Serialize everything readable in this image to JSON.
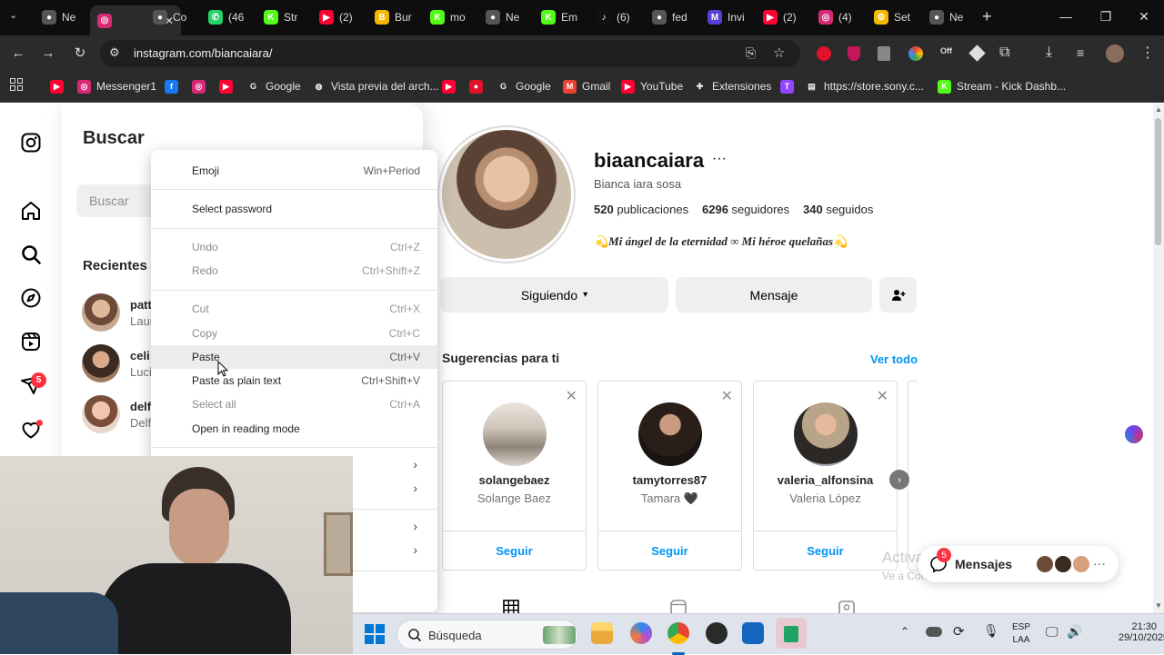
{
  "browser": {
    "tabs": [
      {
        "label": "Ne",
        "icon": "chrome-icon",
        "color": "#555555"
      },
      {
        "label": "",
        "icon": "instagram-icon",
        "color": "#d62976",
        "active": true
      },
      {
        "label": "Co",
        "icon": "chrome-icon",
        "color": "#555555"
      },
      {
        "label": "(46",
        "icon": "whatsapp-icon",
        "color": "#25d366"
      },
      {
        "label": "Str",
        "icon": "kick-icon",
        "color": "#53fc18"
      },
      {
        "label": "(2)",
        "icon": "youtube-icon",
        "color": "#ff0033"
      },
      {
        "label": "Bur",
        "icon": "burger-icon",
        "color": "#f5b800"
      },
      {
        "label": "mo",
        "icon": "kick-icon",
        "color": "#53fc18"
      },
      {
        "label": "Ne",
        "icon": "chrome-icon",
        "color": "#555555"
      },
      {
        "label": "Em",
        "icon": "kick-icon",
        "color": "#53fc18"
      },
      {
        "label": "(6)",
        "icon": "tiktok-icon",
        "color": "#111111"
      },
      {
        "label": "fed",
        "icon": "chrome-icon",
        "color": "#555555"
      },
      {
        "label": "Invi",
        "icon": "mm-icon",
        "color": "#5a3fd6"
      },
      {
        "label": "(2)",
        "icon": "youtube-icon",
        "color": "#ff0033"
      },
      {
        "label": "(4)",
        "icon": "instagram-icon",
        "color": "#d62976"
      },
      {
        "label": "Set",
        "icon": "settings-app-icon",
        "color": "#f5b800"
      },
      {
        "label": "Ne",
        "icon": "chrome-icon",
        "color": "#555555"
      }
    ],
    "url": "instagram.com/biancaiara/",
    "bookmarks": [
      {
        "label": "",
        "icon": "youtube-icon",
        "color": "#ff0033"
      },
      {
        "label": "Messenger1",
        "icon": "instagram-icon",
        "color": "#d62976"
      },
      {
        "label": "",
        "icon": "facebook-icon",
        "color": "#1877f2"
      },
      {
        "label": "",
        "icon": "instagram-icon",
        "color": "#d62976"
      },
      {
        "label": "",
        "icon": "youtube-icon",
        "color": "#ff0033"
      },
      {
        "label": "Google",
        "icon": "google-icon",
        "color": "#ffffff"
      },
      {
        "label": "Vista previa del arch...",
        "icon": "globe-icon",
        "color": "#ffffff"
      },
      {
        "label": "",
        "icon": "youtube-icon",
        "color": "#ff0033"
      },
      {
        "label": "",
        "icon": "app-icon",
        "color": "#e0112b"
      },
      {
        "label": "Google",
        "icon": "google-icon",
        "color": "#ffffff"
      },
      {
        "label": "Gmail",
        "icon": "gmail-icon",
        "color": "#ea4335"
      },
      {
        "label": "YouTube",
        "icon": "youtube-icon",
        "color": "#ff0033"
      },
      {
        "label": "Extensiones",
        "icon": "puzzle-icon",
        "color": "#dddddd"
      },
      {
        "label": "",
        "icon": "twitch-icon",
        "color": "#9146ff"
      },
      {
        "label": "https://store.sony.c...",
        "icon": "page-icon",
        "color": "#dddddd"
      },
      {
        "label": "Stream - Kick Dashb...",
        "icon": "kick-icon",
        "color": "#53fc18"
      }
    ]
  },
  "search": {
    "title": "Buscar",
    "placeholder": "Buscar",
    "recent_label": "Recientes",
    "recents": [
      {
        "name": "patt",
        "sub": "Laur"
      },
      {
        "name": "celi",
        "sub": "Luci"
      },
      {
        "name": "delf",
        "sub": "Delf"
      }
    ]
  },
  "profile": {
    "username": "biaancaiara",
    "fullname": "Bianca iara sosa",
    "posts": "520",
    "posts_label": "publicaciones",
    "followers": "6296",
    "followers_label": "seguidores",
    "following": "340",
    "following_label": "seguidos",
    "bio": "💫Mi ángel de la eternidad ∞ Mi héroe quelañas💫",
    "following_button": "Siguiendo",
    "message_button": "Mensaje"
  },
  "suggestions": {
    "title": "Sugerencias para ti",
    "see_all": "Ver todo",
    "follow_label": "Seguir",
    "cards": [
      {
        "username": "solangebaez",
        "name": "Solange Baez"
      },
      {
        "username": "tamytorres87",
        "name": "Tamara 🖤"
      },
      {
        "username": "valeria_alfonsina",
        "name": "Valeria López"
      }
    ]
  },
  "context_menu": {
    "items": [
      {
        "label": "Emoji",
        "shortcut": "Win+Period",
        "enabled": true
      },
      {
        "label": "Select password",
        "shortcut": "",
        "enabled": true
      },
      {
        "label": "Undo",
        "shortcut": "Ctrl+Z",
        "enabled": false
      },
      {
        "label": "Redo",
        "shortcut": "Ctrl+Shift+Z",
        "enabled": false
      },
      {
        "label": "Cut",
        "shortcut": "Ctrl+X",
        "enabled": false
      },
      {
        "label": "Copy",
        "shortcut": "Ctrl+C",
        "enabled": false
      },
      {
        "label": "Paste",
        "shortcut": "Ctrl+V",
        "enabled": true,
        "hovered": true
      },
      {
        "label": "Paste as plain text",
        "shortcut": "Ctrl+Shift+V",
        "enabled": true
      },
      {
        "label": "Select all",
        "shortcut": "Ctrl+A",
        "enabled": false
      },
      {
        "label": "Open in reading mode",
        "shortcut": "",
        "enabled": true
      }
    ]
  },
  "messages": {
    "label": "Mensajes",
    "badge": "5"
  },
  "notifications_badge": "5",
  "watermark": {
    "line1": "Activar Windows",
    "line2": "Ve a Configuración para activar Windows."
  },
  "taskbar": {
    "search_placeholder": "Búsqueda",
    "lang_line1": "ESP",
    "lang_line2": "LAA",
    "time": "21:30",
    "date": "29/10/2025"
  }
}
